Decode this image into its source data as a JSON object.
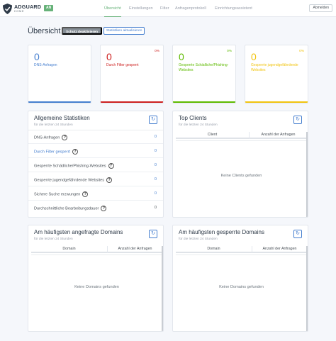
{
  "brand": {
    "name": "ADGUARD",
    "sub": "HOME",
    "status": "AN"
  },
  "nav": {
    "overview": "Übersicht",
    "settings": "Einstellungen",
    "filter": "Filter",
    "query_log": "Anfragenprotokoll",
    "setup": "Einrichtungsassistent",
    "logout": "Abmelden"
  },
  "header": {
    "title": "Übersicht",
    "protection_button": "Schutz deaktivieren",
    "refresh_stats_button": "Statistiken aktualisieren"
  },
  "stat_cards": [
    {
      "value": "0",
      "label": "DNS-Anfragen",
      "percent": "",
      "color": "#467fcf"
    },
    {
      "value": "0",
      "label": "Durch Filter gesperrt",
      "percent": "0%",
      "color": "#cd201f"
    },
    {
      "value": "0",
      "label": "Gesperrte Schädliche/Phishing-Websites",
      "percent": "0%",
      "color": "#5eba00"
    },
    {
      "value": "0",
      "label": "Gesperrte jugendgefährdende Websites",
      "percent": "0%",
      "color": "#f1c40f"
    }
  ],
  "general_stats": {
    "title": "Allgemeine Statistiken",
    "subtitle": "für die letzten 24 Stunden",
    "rows": [
      {
        "label": "DNS-Anfragen",
        "value": "0"
      },
      {
        "label": "Durch Filter gesperrt",
        "value": "0"
      },
      {
        "label": "Gesperrte Schädliche/Phishing-Websites",
        "value": "0"
      },
      {
        "label": "Gesperrte jugendgefährdende Websites",
        "value": "0"
      },
      {
        "label": "Sichere Suche erzwungen",
        "value": "0"
      },
      {
        "label": "Durchschnittliche Bearbeitungsdauer",
        "value": "0"
      }
    ]
  },
  "top_clients": {
    "title": "Top Clients",
    "subtitle": "für die letzten 24 Stunden",
    "col_client": "Client",
    "col_count": "Anzahl der Anfragen",
    "empty": "Keine Clients gefunden"
  },
  "top_queried": {
    "title": "Am häufigsten angefragte Domains",
    "subtitle": "für die letzten 24 Stunden",
    "col_domain": "Domain",
    "col_count": "Anzahl der Anfragen",
    "empty": "Keine Domains gefunden"
  },
  "top_blocked": {
    "title": "Am häufigsten gesperrte Domains",
    "subtitle": "für die letzten 24 Stunden",
    "col_domain": "Domain",
    "col_count": "Anzahl der Anfragen",
    "empty": "Keine Domains gefunden"
  },
  "icons": {
    "refresh": "refresh-icon",
    "help": "help-icon",
    "logo": "shield-logo-icon"
  }
}
